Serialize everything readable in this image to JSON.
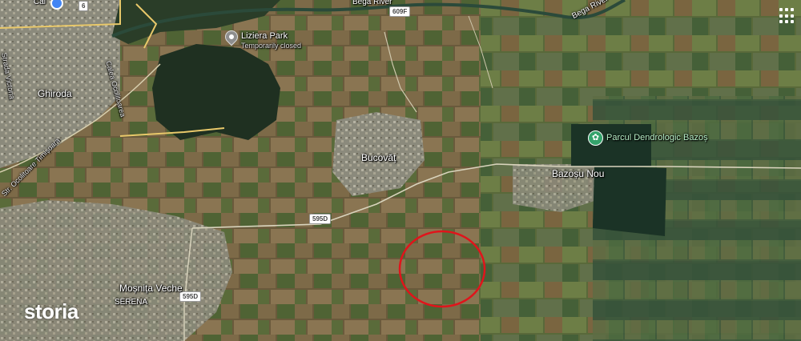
{
  "map": {
    "type": "satellite",
    "grid_icon": "apps-grid-icon",
    "highlight": {
      "shape": "ellipse",
      "color": "#e0141b"
    }
  },
  "labels": {
    "ghiroda": "Ghiroda",
    "bucovat": "Bucovăț",
    "bazosu_nou": "Bazoșu Nou",
    "mosnita_veche": "Moșnița Veche",
    "serena": "SERENA",
    "bega_river_1": "Bega River",
    "bega_river_2": "Bega River",
    "strada_victoria": "Strada Victoria",
    "calea_ocolitoarea": "Calea Ocolitoarea",
    "strada_ocolitoare": "Str. Ocolitoare Timișoara",
    "top_left_partial": "Cal"
  },
  "poi": {
    "liziera_title": "Liziera Park",
    "liziera_status": "Temporarily closed",
    "dendro_title": "Parcul Dendrologic Bazoș"
  },
  "roads": {
    "r609f": "609F",
    "r595d_1": "595D",
    "r595d_2": "595D",
    "r6": "6"
  },
  "branding": {
    "logo": "storia"
  }
}
